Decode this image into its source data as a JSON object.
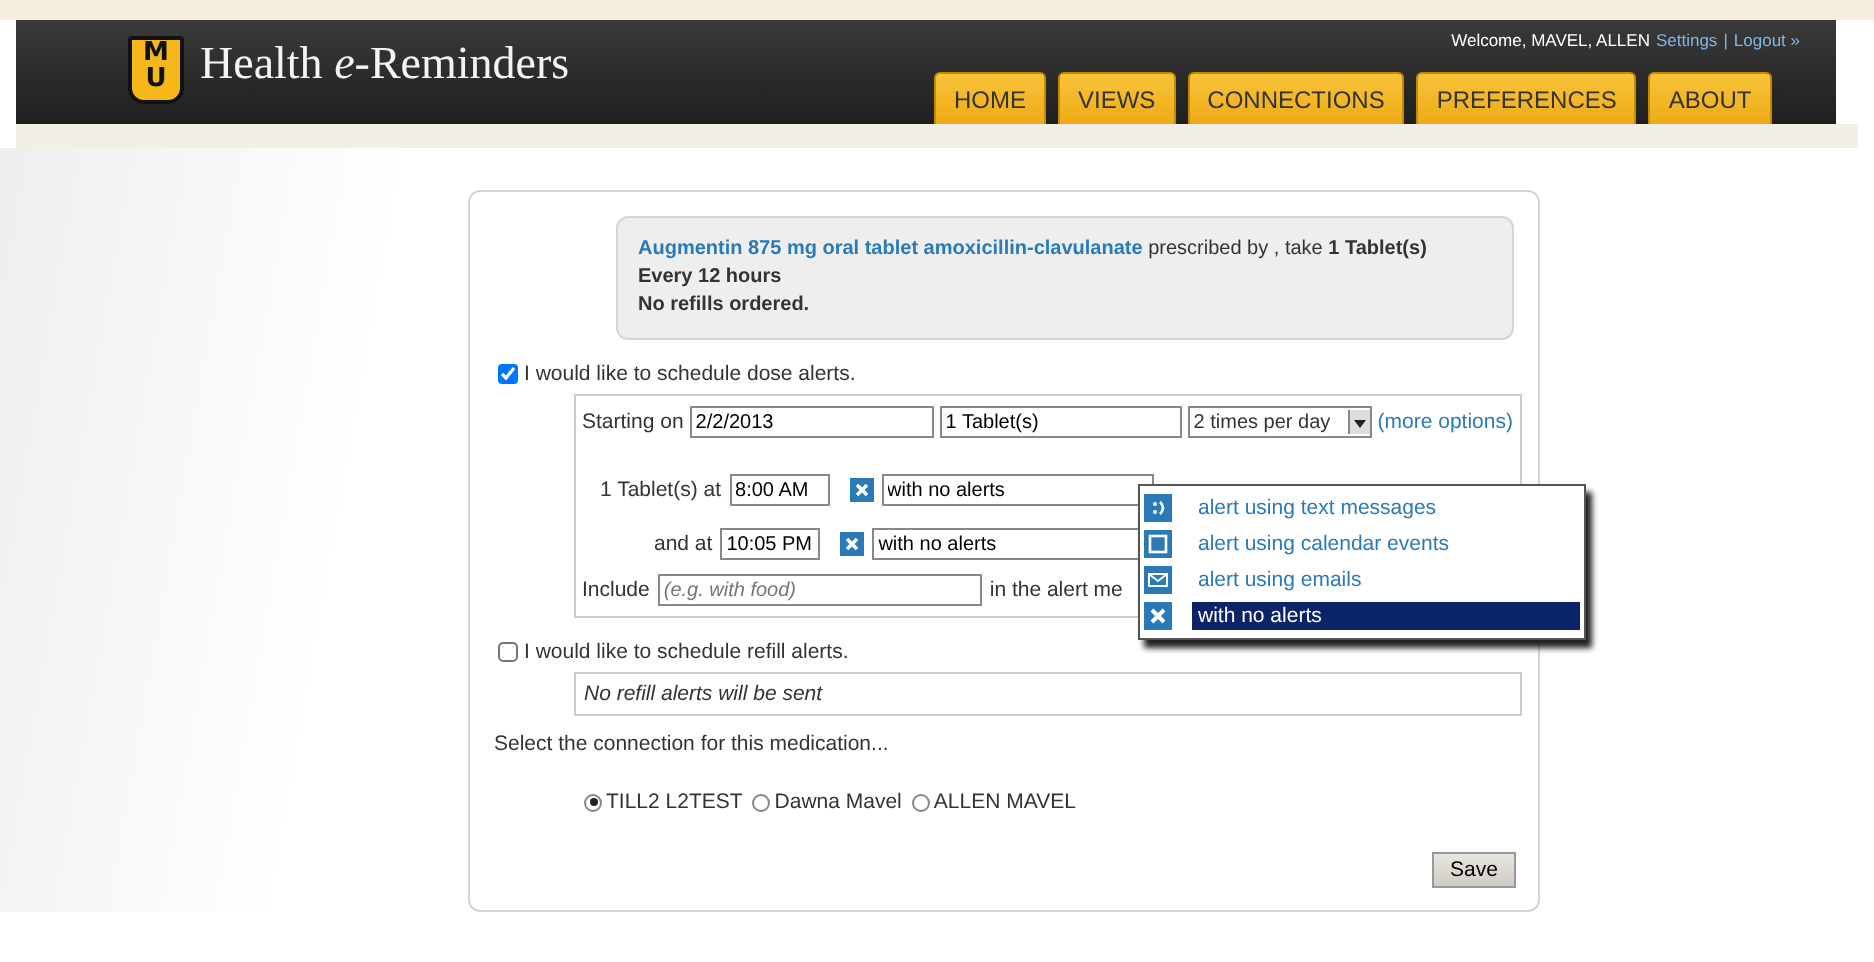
{
  "header": {
    "logo_letters": [
      "M",
      "U"
    ],
    "title": "Health *e*-Reminders",
    "welcome": "Welcome, MAVEL, ALLEN",
    "links": [
      "Settings",
      "|",
      "Logout »"
    ],
    "nav": [
      {
        "label": "HOME"
      },
      {
        "label": "VIEWS"
      },
      {
        "label": "CONNECTIONS"
      },
      {
        "label": "PREFERENCES"
      },
      {
        "label": "ABOUT"
      }
    ]
  },
  "prescription": {
    "drug": "Augmentin 875 mg oral tablet amoxicillin-clavulanate",
    "text": " prescribed by , take **1 Tablet(s)**",
    "lines": [
      "Every 12 hours",
      "No refills ordered."
    ]
  },
  "dose_alerts": {
    "checked": true,
    "label": "I would like to schedule dose alerts.",
    "starting_label": "Starting on",
    "date": "2/2/2013",
    "dose": "1 Tablet(s)",
    "frequency": "2 times per day",
    "more_options": "(more options)",
    "times": [
      {
        "label": "1 Tablet(s) at",
        "time": "8:00 AM",
        "alert": "with no alerts"
      },
      {
        "label": "and at",
        "time": "10:05 PM",
        "alert": "with no alerts"
      }
    ],
    "include_label": "Include",
    "include_placeholder": "(e.g. with food)",
    "include_suffix": "in the alert me"
  },
  "alert_menu": [
    {
      "kind": "text",
      "label": "alert using text messages",
      "selected": false
    },
    {
      "kind": "calendar",
      "label": "alert using calendar events",
      "selected": false
    },
    {
      "kind": "email",
      "label": "alert using emails",
      "selected": false
    },
    {
      "kind": "none",
      "label": "with no alerts",
      "selected": true
    }
  ],
  "refill_alerts": {
    "checked": false,
    "label": "I would like to schedule refill alerts.",
    "note": "No refill alerts will be sent"
  },
  "connection": {
    "prompt": "Select the connection for this medication...",
    "options": [
      {
        "label": "TILL2 L2TEST",
        "selected": true
      },
      {
        "label": "Dawna Mavel",
        "selected": false
      },
      {
        "label": "ALLEN MAVEL",
        "selected": false
      }
    ]
  },
  "save": "Save"
}
